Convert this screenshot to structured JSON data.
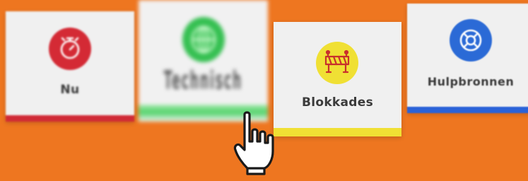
{
  "cards": [
    {
      "label": "Nu",
      "icon": "stopwatch-icon",
      "accent": "#d42a35"
    },
    {
      "label": "Technisch",
      "icon": "globe-icon",
      "accent": "#36c052"
    },
    {
      "label": "Blokkades",
      "icon": "roadblock-icon",
      "accent": "#f0e034"
    },
    {
      "label": "Hulpbronnen",
      "icon": "lifebuoy-icon",
      "accent": "#2b6ad6"
    }
  ],
  "cursor": {
    "icon": "hand-pointer-icon"
  },
  "colors": {
    "background": "#ee7620",
    "card": "#f0f0f0",
    "text": "#3a3a3a"
  }
}
